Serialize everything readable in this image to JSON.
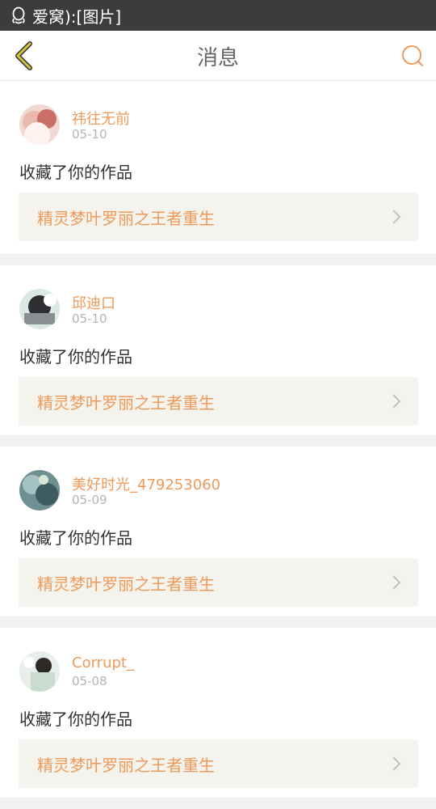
{
  "status": {
    "app_name": "爱窝):[图片]",
    "notification_icon": "qq-icon"
  },
  "header": {
    "title": "消息",
    "back_icon": "back-arrow-icon",
    "search_icon": "search-icon"
  },
  "colors": {
    "accent": "#ef9a58",
    "back_arrow": "#d4c33c",
    "card_bg": "#f4f3ee"
  },
  "messages": [
    {
      "username": "祎往无前",
      "date": "05-10",
      "action": "收藏了你的作品",
      "work_title": "精灵梦叶罗丽之王者重生"
    },
    {
      "username": "邱迪口",
      "date": "05-10",
      "action": "收藏了你的作品",
      "work_title": "精灵梦叶罗丽之王者重生"
    },
    {
      "username": "美好时光_479253060",
      "date": "05-09",
      "action": "收藏了你的作品",
      "work_title": "精灵梦叶罗丽之王者重生"
    },
    {
      "username": "Corrupt_",
      "date": "05-08",
      "action": "收藏了你的作品",
      "work_title": "精灵梦叶罗丽之王者重生"
    }
  ]
}
